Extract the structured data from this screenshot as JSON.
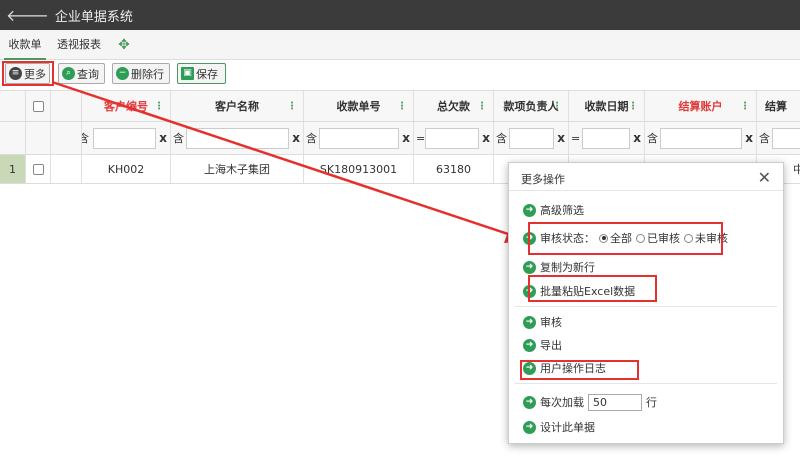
{
  "app": {
    "title": "企业单据系统",
    "back_icon": "arrow-left-icon"
  },
  "tabs": [
    {
      "label": "收款单",
      "active": true
    },
    {
      "label": "透视报表",
      "active": false
    }
  ],
  "tab_move_icon": "move-arrows-icon",
  "toolbar": {
    "more": "更多",
    "query": "查询",
    "delete_row": "删除行",
    "save": "保存"
  },
  "grid": {
    "columns": [
      {
        "label": "客户编号",
        "filter_op": "含"
      },
      {
        "label": "客户名称",
        "filter_op": "含"
      },
      {
        "label": "收款单号",
        "filter_op": "含"
      },
      {
        "label": "总欠款",
        "filter_op": "="
      },
      {
        "label": "款项负责人",
        "filter_op": "含"
      },
      {
        "label": "收款日期",
        "filter_op": "="
      },
      {
        "label": "结算账户",
        "filter_op": "含"
      },
      {
        "label": "结算",
        "filter_op": "含"
      }
    ],
    "rows": [
      {
        "num": "1",
        "cells": [
          "KH002",
          "上海木子集团",
          "SK180913001",
          "63180",
          "",
          "",
          "",
          "中"
        ]
      }
    ]
  },
  "modal": {
    "title": "更多操作",
    "advanced_filter": "高级筛选",
    "audit_status_label": "审核状态：",
    "audit_options": [
      "全部",
      "已审核",
      "未审核"
    ],
    "copy_new": "复制为新行",
    "paste_excel": "批量粘贴Excel数据",
    "audit": "审核",
    "export": "导出",
    "user_log": "用户操作日志",
    "load_label": "每次加载",
    "load_value": "50",
    "load_unit": "行",
    "design": "设计此单据"
  },
  "colors": {
    "accent_green": "#2e9e56",
    "highlight_red": "#e53030",
    "title_bar": "#3b3b3b"
  }
}
